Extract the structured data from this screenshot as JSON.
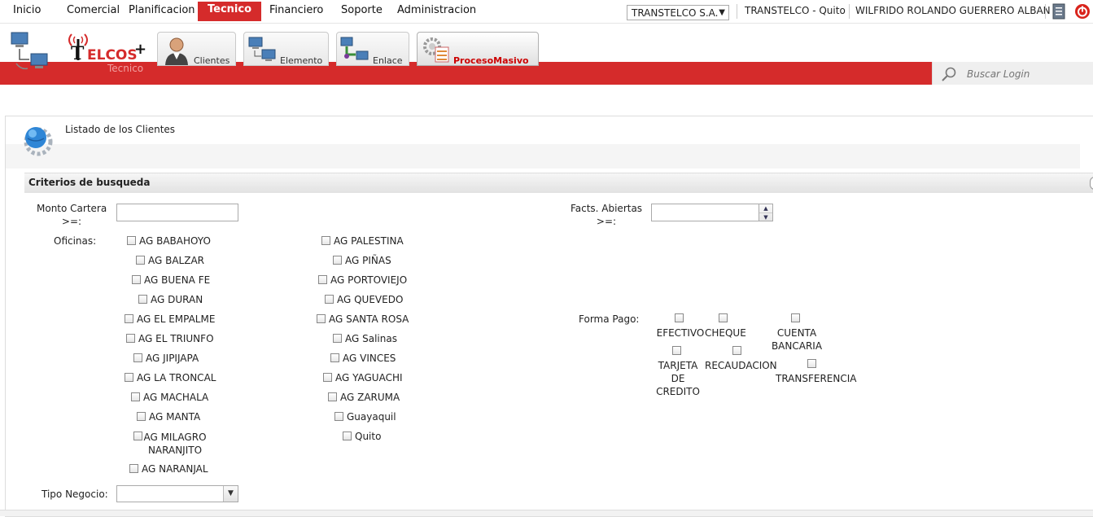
{
  "nav": {
    "items": [
      "Inicio",
      "Comercial",
      "Planificacion",
      "Tecnico",
      "Financiero",
      "Soporte",
      "Administracion"
    ],
    "active": "Tecnico"
  },
  "header": {
    "company_select": "TRANSTELCO S.A.",
    "company_office": "TRANSTELCO - Quito",
    "user_name": "WILFRIDO ROLANDO GUERRERO ALBAN"
  },
  "logo": {
    "text": "TELCOS",
    "sub": "Tecnico"
  },
  "modules": [
    {
      "label": "Clientes",
      "active": false
    },
    {
      "label": "Elemento",
      "active": false
    },
    {
      "label": "Enlace",
      "active": false
    },
    {
      "label": "ProcesoMasivo",
      "active": true
    }
  ],
  "search": {
    "placeholder": "Buscar Login"
  },
  "panel": {
    "title": "Listado de los Clientes"
  },
  "criteria": {
    "title": "Criterios de busqueda",
    "monto_cartera_label": "Monto Cartera\n>=:",
    "monto_cartera_value": "",
    "facts_abiertas_label": "Facts. Abiertas\n>=:",
    "facts_abiertas_value": "",
    "oficinas_label": "Oficinas:",
    "oficinas_col1": [
      "AG BABAHOYO",
      "AG BALZAR",
      "AG BUENA FE",
      "AG DURAN",
      "AG EL EMPALME",
      "AG EL TRIUNFO",
      "AG JIPIJAPA",
      "AG LA TRONCAL",
      "AG MACHALA",
      "AG MANTA",
      "AG MILAGRO\nNARANJITO",
      "AG NARANJAL"
    ],
    "oficinas_col2": [
      "AG PALESTINA",
      "AG PIÑAS",
      "AG PORTOVIEJO",
      "AG QUEVEDO",
      "AG SANTA ROSA",
      "AG Salinas",
      "AG VINCES",
      "AG YAGUACHI",
      "AG ZARUMA",
      "Guayaquil",
      "Quito"
    ],
    "forma_pago_label": "Forma Pago:",
    "forma_pago": [
      "EFECTIVO",
      "CHEQUE",
      "CUENTA\nBANCARIA",
      "TARJETA\nDE\nCREDITO",
      "RECAUDACION",
      "TRANSFERENCIA"
    ],
    "tipo_negocio_label": "Tipo Negocio:",
    "tipo_negocio_value": ""
  },
  "colors": {
    "brand_red": "#d52b2b"
  }
}
